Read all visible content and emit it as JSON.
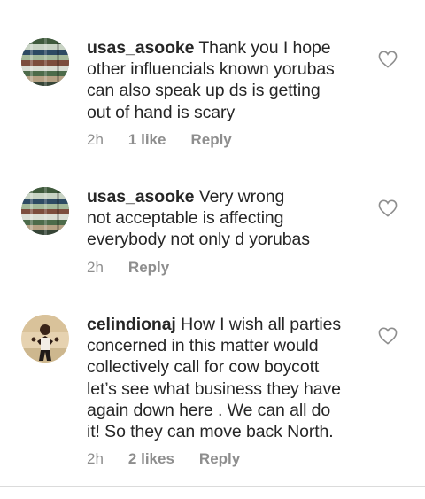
{
  "comments": [
    {
      "username": "usas_asooke",
      "lines": [
        "Thank you I hope",
        "other influencials known yorubas",
        "can also speak up ds  is getting",
        "out of hand is scary"
      ],
      "time": "2h",
      "likes": "1 like",
      "reply": "Reply",
      "avatar": "fabric-avatar"
    },
    {
      "username": "usas_asooke",
      "lines": [
        "Very wrong",
        "not acceptable is affecting",
        "everybody not only d yorubas"
      ],
      "time": "2h",
      "likes": "",
      "reply": "Reply",
      "avatar": "fabric-avatar"
    },
    {
      "username": "celindionaj",
      "lines": [
        "How I wish all parties",
        "concerned in this matter would",
        "collectively call for cow boycott",
        "let’s see what business they have",
        "again down here . We can all do",
        "it! So they can move back North."
      ],
      "time": "2h",
      "likes": "2 likes",
      "reply": "Reply",
      "avatar": "person-avatar"
    }
  ],
  "icons": {
    "like": "heart-outline-icon"
  },
  "colors": {
    "text": "#262626",
    "secondary": "#8e8e8e",
    "divider": "#dbdbdb"
  }
}
